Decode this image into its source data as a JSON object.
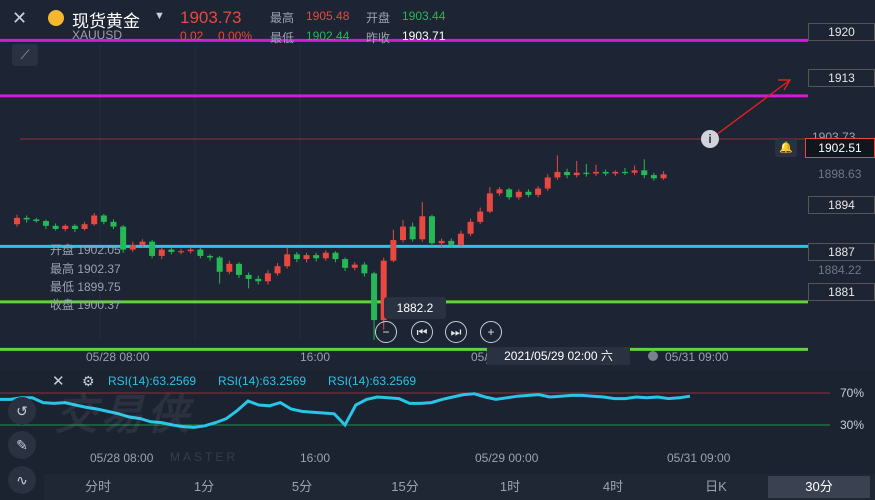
{
  "header": {
    "title": "现货黄金",
    "symbol": "XAUUSD",
    "price": "1903.73",
    "change": "0.02",
    "change_pct": "0.00%",
    "high_label": "最高",
    "high_value": "1905.48",
    "open_label": "开盘",
    "open_value": "1903.44",
    "low_label": "最低",
    "low_value": "1902.44",
    "prev_label": "昨收",
    "prev_value": "1903.71"
  },
  "levels": [
    {
      "label": "1920",
      "color": "#d21bd2"
    },
    {
      "label": "1913",
      "color": "#d21bd2"
    },
    {
      "label": "1894",
      "color": "#29c4e8"
    },
    {
      "label": "1887",
      "color": "#5fd33c"
    },
    {
      "label": "1881",
      "color": "#5fd33c"
    }
  ],
  "right_axis": {
    "current_price": "1902.51",
    "hidden_price": "1903.73",
    "tick_upper": "1898.63",
    "tick_lower": "1884.22"
  },
  "ohlc_box": {
    "open": "开盘 1902.05",
    "high": "最高 1902.37",
    "low": "最低 1899.75",
    "close": "收盘 1900.37"
  },
  "tooltip_price": "1882.2",
  "crosshair_time": "2021/05/29 02:00 六",
  "time_axis": [
    "05/28 08:00",
    "16:00",
    "05/",
    "05/31 09:00"
  ],
  "rsi": {
    "labels": [
      "RSI(14):63.2569",
      "RSI(14):63.2569",
      "RSI(14):63.2569"
    ],
    "level_high": "70%",
    "level_low": "30%",
    "time_axis": [
      "05/28 08:00",
      "16:00",
      "05/29 00:00",
      "05/31 09:00"
    ],
    "values": [
      62,
      62,
      64,
      64,
      58,
      57,
      58,
      55,
      52,
      50,
      47,
      44,
      40,
      38,
      34,
      33,
      30,
      28,
      27,
      29,
      33,
      38,
      48,
      60,
      55,
      54,
      58,
      50,
      47,
      46,
      45,
      44,
      30,
      55,
      62,
      65,
      64,
      63,
      57,
      57,
      58,
      62,
      65,
      68,
      69,
      65,
      62,
      64,
      66,
      67,
      68,
      65,
      66,
      67,
      67,
      66,
      65,
      63,
      63,
      65,
      64,
      65,
      63,
      64,
      66
    ]
  },
  "watermark": {
    "main": "交易侠",
    "sub": "MASTER"
  },
  "timeframes": [
    "分时",
    "1分",
    "5分",
    "15分",
    "1时",
    "4时",
    "日K",
    "30分"
  ],
  "chart_data": {
    "type": "candlestick",
    "candles": [
      {
        "o": 1896.8,
        "c": 1897.6,
        "h": 1898,
        "l": 1896.5
      },
      {
        "o": 1897.6,
        "c": 1897.4,
        "h": 1897.9,
        "l": 1897
      },
      {
        "o": 1897.4,
        "c": 1897.2,
        "h": 1897.6,
        "l": 1897
      },
      {
        "o": 1897.2,
        "c": 1896.6,
        "h": 1897.4,
        "l": 1896.2
      },
      {
        "o": 1896.6,
        "c": 1896.2,
        "h": 1896.9,
        "l": 1896
      },
      {
        "o": 1896.2,
        "c": 1896.6,
        "h": 1896.8,
        "l": 1895.9
      },
      {
        "o": 1896.6,
        "c": 1896.2,
        "h": 1896.8,
        "l": 1895.8
      },
      {
        "o": 1896.2,
        "c": 1896.8,
        "h": 1897.1,
        "l": 1896
      },
      {
        "o": 1896.8,
        "c": 1897.9,
        "h": 1898.2,
        "l": 1896.6
      },
      {
        "o": 1897.9,
        "c": 1897.1,
        "h": 1898.1,
        "l": 1896.8
      },
      {
        "o": 1897.1,
        "c": 1896.5,
        "h": 1897.4,
        "l": 1896.2
      },
      {
        "o": 1896.5,
        "c": 1893.6,
        "h": 1896.7,
        "l": 1893.2
      },
      {
        "o": 1893.6,
        "c": 1894.2,
        "h": 1894.6,
        "l": 1893.3
      },
      {
        "o": 1894.2,
        "c": 1894.6,
        "h": 1894.9,
        "l": 1893.9
      },
      {
        "o": 1894.6,
        "c": 1892.8,
        "h": 1894.8,
        "l": 1892.5
      },
      {
        "o": 1892.8,
        "c": 1893.6,
        "h": 1893.9,
        "l": 1892.4
      },
      {
        "o": 1893.6,
        "c": 1893.3,
        "h": 1893.9,
        "l": 1893
      },
      {
        "o": 1893.3,
        "c": 1893.4,
        "h": 1893.7,
        "l": 1893
      },
      {
        "o": 1893.4,
        "c": 1893.6,
        "h": 1893.9,
        "l": 1893.1
      },
      {
        "o": 1893.6,
        "c": 1892.8,
        "h": 1893.8,
        "l": 1892.5
      },
      {
        "o": 1892.8,
        "c": 1892.6,
        "h": 1893,
        "l": 1892.2
      },
      {
        "o": 1892.6,
        "c": 1890.8,
        "h": 1892.8,
        "l": 1889.3
      },
      {
        "o": 1890.8,
        "c": 1891.8,
        "h": 1892.2,
        "l": 1890.5
      },
      {
        "o": 1891.8,
        "c": 1890.4,
        "h": 1892,
        "l": 1890
      },
      {
        "o": 1890.4,
        "c": 1889.9,
        "h": 1890.7,
        "l": 1888.7
      },
      {
        "o": 1889.9,
        "c": 1889.6,
        "h": 1890.3,
        "l": 1889.2
      },
      {
        "o": 1889.6,
        "c": 1890.6,
        "h": 1891,
        "l": 1889.2
      },
      {
        "o": 1890.6,
        "c": 1891.5,
        "h": 1891.9,
        "l": 1890.3
      },
      {
        "o": 1891.5,
        "c": 1893,
        "h": 1893.8,
        "l": 1891.2
      },
      {
        "o": 1893,
        "c": 1892.4,
        "h": 1893.3,
        "l": 1892
      },
      {
        "o": 1892.4,
        "c": 1892.9,
        "h": 1893.2,
        "l": 1892
      },
      {
        "o": 1892.9,
        "c": 1892.5,
        "h": 1893.2,
        "l": 1892.1
      },
      {
        "o": 1892.5,
        "c": 1893.2,
        "h": 1893.5,
        "l": 1892.2
      },
      {
        "o": 1893.2,
        "c": 1892.4,
        "h": 1893.4,
        "l": 1892
      },
      {
        "o": 1892.4,
        "c": 1891.3,
        "h": 1892.6,
        "l": 1890.9
      },
      {
        "o": 1891.3,
        "c": 1891.7,
        "h": 1892,
        "l": 1891
      },
      {
        "o": 1891.7,
        "c": 1890.6,
        "h": 1892,
        "l": 1890.2
      },
      {
        "o": 1890.6,
        "c": 1884.7,
        "h": 1890.8,
        "l": 1882.2
      },
      {
        "o": 1884.7,
        "c": 1892.2,
        "h": 1892.6,
        "l": 1883.5
      },
      {
        "o": 1892.2,
        "c": 1894.8,
        "h": 1896.1,
        "l": 1892
      },
      {
        "o": 1894.8,
        "c": 1896.5,
        "h": 1897.3,
        "l": 1894.5
      },
      {
        "o": 1896.5,
        "c": 1894.9,
        "h": 1897,
        "l": 1894.6
      },
      {
        "o": 1894.9,
        "c": 1897.8,
        "h": 1899.6,
        "l": 1894.6
      },
      {
        "o": 1897.8,
        "c": 1894.4,
        "h": 1898,
        "l": 1894
      },
      {
        "o": 1894.4,
        "c": 1894.7,
        "h": 1895,
        "l": 1893.9
      },
      {
        "o": 1894.7,
        "c": 1894.2,
        "h": 1895,
        "l": 1893.8
      },
      {
        "o": 1894.2,
        "c": 1895.6,
        "h": 1896,
        "l": 1894
      },
      {
        "o": 1895.6,
        "c": 1897.1,
        "h": 1897.5,
        "l": 1895.3
      },
      {
        "o": 1897.1,
        "c": 1898.4,
        "h": 1898.9,
        "l": 1896.8
      },
      {
        "o": 1898.4,
        "c": 1900.7,
        "h": 1901.5,
        "l": 1898.2
      },
      {
        "o": 1900.7,
        "c": 1901.2,
        "h": 1901.5,
        "l": 1900.4
      },
      {
        "o": 1901.2,
        "c": 1900.2,
        "h": 1901.4,
        "l": 1899.9
      },
      {
        "o": 1900.2,
        "c": 1900.9,
        "h": 1901.2,
        "l": 1899.9
      },
      {
        "o": 1900.9,
        "c": 1900.5,
        "h": 1901.2,
        "l": 1900.2
      },
      {
        "o": 1900.5,
        "c": 1901.3,
        "h": 1901.6,
        "l": 1900.2
      },
      {
        "o": 1901.3,
        "c": 1902.7,
        "h": 1903.1,
        "l": 1901
      },
      {
        "o": 1902.7,
        "c": 1903.4,
        "h": 1905.5,
        "l": 1902.4
      },
      {
        "o": 1903.4,
        "c": 1903,
        "h": 1903.8,
        "l": 1902.6
      },
      {
        "o": 1903,
        "c": 1903.3,
        "h": 1904.8,
        "l": 1902.7
      },
      {
        "o": 1903.3,
        "c": 1903.2,
        "h": 1904.4,
        "l": 1902.8
      },
      {
        "o": 1903.2,
        "c": 1903.4,
        "h": 1904.3,
        "l": 1902.9
      },
      {
        "o": 1903.4,
        "c": 1903.2,
        "h": 1903.7,
        "l": 1902.9
      },
      {
        "o": 1903.2,
        "c": 1903.4,
        "h": 1903.6,
        "l": 1902.9
      },
      {
        "o": 1903.4,
        "c": 1903.3,
        "h": 1903.9,
        "l": 1903
      },
      {
        "o": 1903.3,
        "c": 1903.6,
        "h": 1904.2,
        "l": 1903
      },
      {
        "o": 1903.6,
        "c": 1903,
        "h": 1905,
        "l": 1902.6
      },
      {
        "o": 1903,
        "c": 1902.6,
        "h": 1903.3,
        "l": 1902.3
      },
      {
        "o": 1902.6,
        "c": 1903.1,
        "h": 1903.5,
        "l": 1902.4
      }
    ],
    "up_color": "#e8483f",
    "down_color": "#26b854",
    "ylim": [
      1878.4,
      1925.1
    ]
  }
}
